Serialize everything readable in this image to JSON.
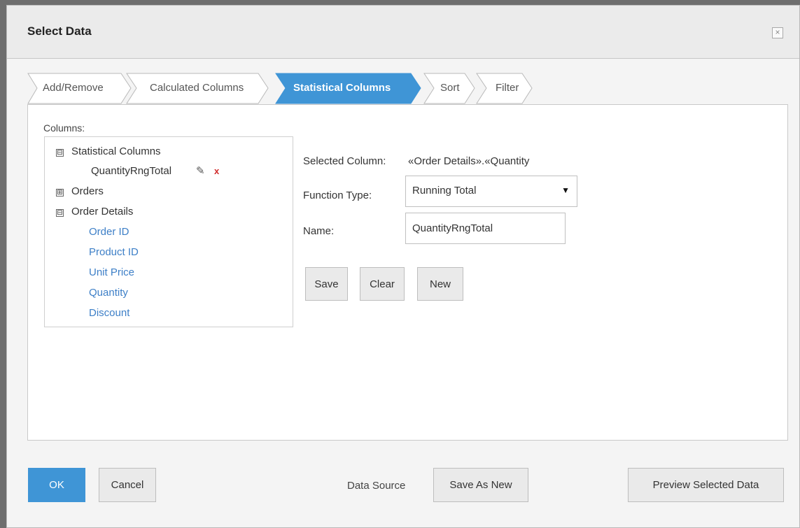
{
  "dialog": {
    "title": "Select Data",
    "close_glyph": "×",
    "close_icon": "close-icon"
  },
  "tabs": [
    {
      "label": "Add/Remove",
      "active": false
    },
    {
      "label": "Calculated Columns",
      "active": false
    },
    {
      "label": "Statistical Columns",
      "active": true
    },
    {
      "label": "Sort",
      "active": false
    },
    {
      "label": "Filter",
      "active": false
    }
  ],
  "columns": {
    "label": "Columns:",
    "tree": {
      "statistical_group": {
        "toggle": "⊟",
        "label": "Statistical Columns",
        "child": "QuantityRngTotal",
        "edit_icon": "pencil-icon",
        "delete_icon": "delete-x-icon",
        "delete_glyph": "x"
      },
      "orders_group": {
        "toggle": "⊞",
        "label": "Orders"
      },
      "order_details_group": {
        "toggle": "⊟",
        "label": "Order Details",
        "fields": [
          "Order ID",
          "Product ID",
          "Unit Price",
          "Quantity",
          "Discount"
        ]
      }
    }
  },
  "form": {
    "selected_column_label": "Selected Column:",
    "selected_column_value": "«Order Details».«Quantity",
    "function_type_label": "Function Type:",
    "function_type_value": "Running Total",
    "function_type_arrow": "▼",
    "name_label": "Name:",
    "name_value": "QuantityRngTotal",
    "buttons": {
      "save": "Save",
      "clear": "Clear",
      "new": "New"
    }
  },
  "footer": {
    "ok": "OK",
    "cancel": "Cancel",
    "data_source_label": "Data Source",
    "save_as_new": "Save As New",
    "preview": "Preview Selected Data"
  },
  "colors": {
    "accent": "#3f95d6",
    "link": "#3d7fc7",
    "delete": "#d12c2c"
  }
}
